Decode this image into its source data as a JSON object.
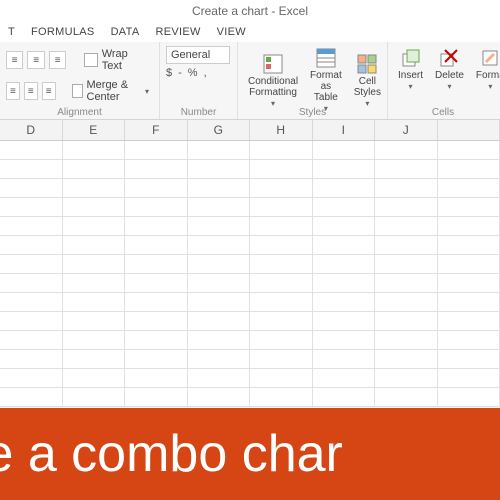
{
  "title": "Create a chart - Excel",
  "menu": {
    "items": [
      "T",
      "FORMULAS",
      "DATA",
      "REVIEW",
      "VIEW"
    ]
  },
  "ribbon": {
    "alignment": {
      "label": "Alignment",
      "wrap": "Wrap Text",
      "merge": "Merge & Center"
    },
    "number": {
      "label": "Number",
      "format": "General",
      "currency": "$",
      "percent": "%",
      "comma": ","
    },
    "styles": {
      "label": "Styles",
      "cond": "Conditional\nFormatting",
      "table": "Format as\nTable",
      "cell": "Cell\nStyles"
    },
    "cells": {
      "label": "Cells",
      "insert": "Insert",
      "delete": "Delete",
      "format": "Forma"
    }
  },
  "columns": [
    "D",
    "E",
    "F",
    "G",
    "H",
    "I",
    "J"
  ],
  "row_count": 14,
  "banner": "te a combo char"
}
